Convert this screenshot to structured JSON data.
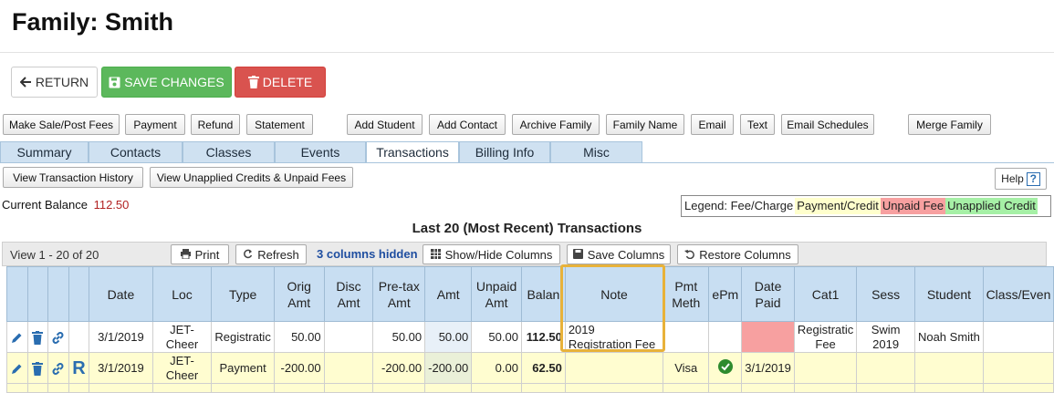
{
  "page": {
    "title": "Family: Smith"
  },
  "main_buttons": {
    "return": "RETURN",
    "save": "SAVE CHANGES",
    "delete": "DELETE"
  },
  "actions": [
    "Make Sale/Post Fees",
    "Payment",
    "Refund",
    "Statement",
    "Add Student",
    "Add Contact",
    "Archive Family",
    "Family Name",
    "Email",
    "Text",
    "Email Schedules",
    "Merge Family"
  ],
  "tabs": [
    "Summary",
    "Contacts",
    "Classes",
    "Events",
    "Transactions",
    "Billing Info",
    "Misc"
  ],
  "active_tab": "Transactions",
  "sub_actions": {
    "history": "View Transaction History",
    "unapplied": "View Unapplied Credits & Unpaid Fees",
    "help": "Help"
  },
  "balance": {
    "label": "Current Balance",
    "value": "112.50"
  },
  "legend": {
    "fee": "Legend: Fee/Charge",
    "payment": "Payment/Credit",
    "unpaid": "Unpaid Fee",
    "credit": "Unapplied Credit"
  },
  "section_title": "Last 20 (Most Recent) Transactions",
  "toolbar": {
    "view": "View 1 - 20 of 20",
    "print": "Print",
    "refresh": "Refresh",
    "hidden": "3 columns hidden",
    "show_hide": "Show/Hide Columns",
    "save_cols": "Save Columns",
    "restore_cols": "Restore Columns"
  },
  "columns": [
    "Date",
    "Loc",
    "Type",
    "Orig Amt",
    "Disc Amt",
    "Pre-tax Amt",
    "Amt",
    "Unpaid Amt",
    "Balan",
    "Note",
    "Pmt Meth",
    "ePm",
    "Date Paid",
    "Cat1",
    "Sess",
    "Student",
    "Class/Even"
  ],
  "rows": [
    {
      "date": "3/1/2019",
      "loc": "JET-Cheer",
      "type": "Registratic",
      "orig": "50.00",
      "disc": "",
      "pretax": "50.00",
      "amt": "50.00",
      "unpaid": "50.00",
      "balance": "112.50",
      "note": "2019 Registration Fee",
      "pmt": "",
      "epm": "",
      "date_paid": "",
      "cat1": "Registratic Fee",
      "sess": "Swim 2019",
      "student": "Noah Smith",
      "class": "",
      "refund_flag": ""
    },
    {
      "date": "3/1/2019",
      "loc": "JET-Cheer",
      "type": "Payment",
      "orig": "-200.00",
      "disc": "",
      "pretax": "-200.00",
      "amt": "-200.00",
      "unpaid": "0.00",
      "balance": "62.50",
      "note": "",
      "pmt": "Visa",
      "epm": "check-circle-icon",
      "date_paid": "3/1/2019",
      "cat1": "",
      "sess": "",
      "student": "",
      "class": "",
      "refund_flag": "R"
    }
  ],
  "colors": {
    "accent_tab": "#cfe1f1",
    "save": "#5cb85c",
    "delete": "#d9534f",
    "payment_row": "#fffdd0",
    "unpaid": "#f7a0a0",
    "highlight": "#e8b23a"
  }
}
